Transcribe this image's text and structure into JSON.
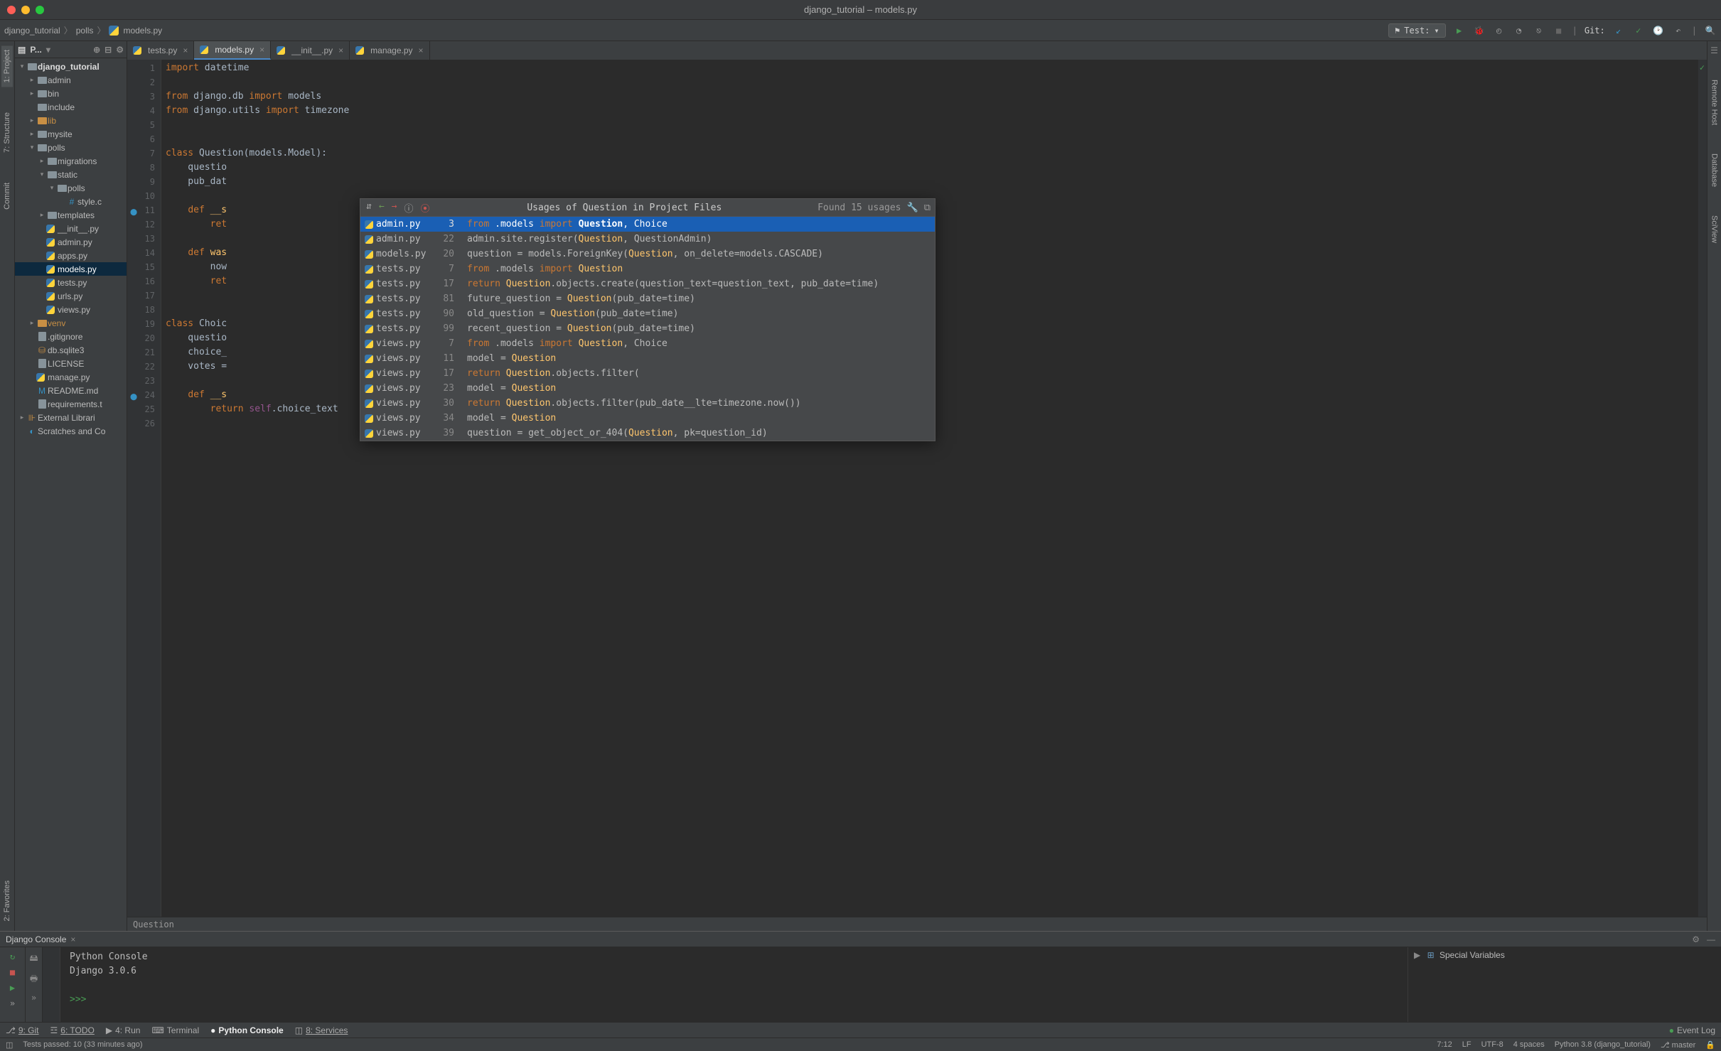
{
  "window_title": "django_tutorial – models.py",
  "breadcrumb": [
    "django_tutorial",
    "polls",
    "models.py"
  ],
  "run_config": {
    "icon": "Test:",
    "label": "Test:"
  },
  "toolbar_icons": [
    "run",
    "debug",
    "coverage",
    "profile",
    "concurrency",
    "stop",
    "git-update",
    "git-commit",
    "git-history",
    "revert",
    "search"
  ],
  "git_label": "Git:",
  "left_tool_tabs": [
    {
      "name": "1: Project",
      "active": true
    },
    {
      "name": "7: Structure",
      "active": false
    },
    {
      "name": "Commit",
      "active": false
    },
    {
      "name": "2: Favorites",
      "active": false
    }
  ],
  "right_tool_tabs": [
    "Remote Host",
    "Database",
    "SciView"
  ],
  "project_panel": {
    "title": "P...",
    "tree": [
      {
        "d": 0,
        "exp": "v",
        "t": "folder",
        "label": "django_tutorial",
        "bold": true
      },
      {
        "d": 1,
        "exp": ">",
        "t": "folder",
        "label": "admin"
      },
      {
        "d": 1,
        "exp": ">",
        "t": "folder",
        "label": "bin"
      },
      {
        "d": 1,
        "exp": "",
        "t": "folder",
        "label": "include"
      },
      {
        "d": 1,
        "exp": ">",
        "t": "folder-lib",
        "label": "lib"
      },
      {
        "d": 1,
        "exp": ">",
        "t": "folder",
        "label": "mysite"
      },
      {
        "d": 1,
        "exp": "v",
        "t": "folder",
        "label": "polls"
      },
      {
        "d": 2,
        "exp": ">",
        "t": "folder",
        "label": "migrations"
      },
      {
        "d": 2,
        "exp": "v",
        "t": "folder",
        "label": "static"
      },
      {
        "d": 3,
        "exp": "v",
        "t": "folder",
        "label": "polls"
      },
      {
        "d": 4,
        "exp": "",
        "t": "css",
        "label": "style.c"
      },
      {
        "d": 2,
        "exp": ">",
        "t": "folder",
        "label": "templates"
      },
      {
        "d": 2,
        "exp": "",
        "t": "py",
        "label": "__init__.py"
      },
      {
        "d": 2,
        "exp": "",
        "t": "py",
        "label": "admin.py"
      },
      {
        "d": 2,
        "exp": "",
        "t": "py",
        "label": "apps.py"
      },
      {
        "d": 2,
        "exp": "",
        "t": "py",
        "label": "models.py",
        "sel": true
      },
      {
        "d": 2,
        "exp": "",
        "t": "py",
        "label": "tests.py"
      },
      {
        "d": 2,
        "exp": "",
        "t": "py",
        "label": "urls.py"
      },
      {
        "d": 2,
        "exp": "",
        "t": "py",
        "label": "views.py"
      },
      {
        "d": 1,
        "exp": ">",
        "t": "folder-lib",
        "label": "venv"
      },
      {
        "d": 1,
        "exp": "",
        "t": "file",
        "label": ".gitignore"
      },
      {
        "d": 1,
        "exp": "",
        "t": "db",
        "label": "db.sqlite3"
      },
      {
        "d": 1,
        "exp": "",
        "t": "file",
        "label": "LICENSE"
      },
      {
        "d": 1,
        "exp": "",
        "t": "py",
        "label": "manage.py"
      },
      {
        "d": 1,
        "exp": "",
        "t": "md",
        "label": "README.md"
      },
      {
        "d": 1,
        "exp": "",
        "t": "file",
        "label": "requirements.t"
      },
      {
        "d": 0,
        "exp": ">",
        "t": "lib",
        "label": "External Librari"
      },
      {
        "d": 0,
        "exp": "",
        "t": "scratch",
        "label": "Scratches and Co"
      }
    ]
  },
  "tabs": [
    {
      "label": "tests.py",
      "active": false
    },
    {
      "label": "models.py",
      "active": true
    },
    {
      "label": "__init__.py",
      "active": false
    },
    {
      "label": "manage.py",
      "active": false
    }
  ],
  "code": {
    "lines": [
      {
        "n": 1,
        "html": "<span class='kw'>import</span> datetime"
      },
      {
        "n": 2,
        "html": ""
      },
      {
        "n": 3,
        "html": "<span class='kw'>from</span> django.db <span class='kw'>import</span> models"
      },
      {
        "n": 4,
        "html": "<span class='kw'>from</span> django.utils <span class='kw'>import</span> timezone"
      },
      {
        "n": 5,
        "html": ""
      },
      {
        "n": 6,
        "html": ""
      },
      {
        "n": 7,
        "html": "<span class='kw'>class</span> Question(models.Model):",
        "caret": true
      },
      {
        "n": 8,
        "html": "    questio"
      },
      {
        "n": 9,
        "html": "    pub_dat"
      },
      {
        "n": 10,
        "html": ""
      },
      {
        "n": 11,
        "html": "    <span class='kw'>def</span> <span class='fn'>__s</span>",
        "icon": "o"
      },
      {
        "n": 12,
        "html": "        <span class='kw'>ret</span>"
      },
      {
        "n": 13,
        "html": ""
      },
      {
        "n": 14,
        "html": "    <span class='kw'>def</span> <span class='fn'>was</span>"
      },
      {
        "n": 15,
        "html": "        now"
      },
      {
        "n": 16,
        "html": "        <span class='kw'>ret</span>"
      },
      {
        "n": 17,
        "html": ""
      },
      {
        "n": 18,
        "html": ""
      },
      {
        "n": 19,
        "html": "<span class='kw'>class</span> Choic"
      },
      {
        "n": 20,
        "html": "    questio"
      },
      {
        "n": 21,
        "html": "    choice_"
      },
      {
        "n": 22,
        "html": "    votes ="
      },
      {
        "n": 23,
        "html": ""
      },
      {
        "n": 24,
        "html": "    <span class='kw'>def</span> <span class='fn'>__s</span>",
        "icon": "o"
      },
      {
        "n": 25,
        "html": "        <span class='kw'>return</span> <span class='self'>self</span>.choice_text"
      },
      {
        "n": 26,
        "html": ""
      }
    ]
  },
  "editor_breadcrumb": "Question",
  "usages": {
    "title": "Usages of Question in Project Files",
    "found": "Found 15 usages",
    "rows": [
      {
        "file": "admin.py",
        "line": 3,
        "sel": true,
        "html": "<span class='kw'>from</span> .models <span class='kw'>import</span> <span class='hl'>Question</span>, Choice"
      },
      {
        "file": "admin.py",
        "line": 22,
        "html": "admin.site.register(<span class='hl'>Question</span>, QuestionAdmin)"
      },
      {
        "file": "models.py",
        "line": 20,
        "html": "question = models.ForeignKey(<span class='hl'>Question</span>, on_delete=models.CASCADE)"
      },
      {
        "file": "tests.py",
        "line": 7,
        "html": "<span class='kw'>from</span> .models <span class='kw'>import</span> <span class='hl'>Question</span>"
      },
      {
        "file": "tests.py",
        "line": 17,
        "html": "<span class='kw'>return</span> <span class='hl'>Question</span>.objects.create(question_text=question_text, pub_date=time)"
      },
      {
        "file": "tests.py",
        "line": 81,
        "html": "future_question = <span class='hl'>Question</span>(pub_date=time)"
      },
      {
        "file": "tests.py",
        "line": 90,
        "html": "old_question = <span class='hl'>Question</span>(pub_date=time)"
      },
      {
        "file": "tests.py",
        "line": 99,
        "html": "recent_question = <span class='hl'>Question</span>(pub_date=time)"
      },
      {
        "file": "views.py",
        "line": 7,
        "html": "<span class='kw'>from</span> .models <span class='kw'>import</span> <span class='hl'>Question</span>, Choice"
      },
      {
        "file": "views.py",
        "line": 11,
        "html": "model = <span class='hl'>Question</span>"
      },
      {
        "file": "views.py",
        "line": 17,
        "html": "<span class='kw'>return</span> <span class='hl'>Question</span>.objects.filter("
      },
      {
        "file": "views.py",
        "line": 23,
        "html": "model = <span class='hl'>Question</span>"
      },
      {
        "file": "views.py",
        "line": 30,
        "html": "<span class='kw'>return</span> <span class='hl'>Question</span>.objects.filter(pub_date__lte=timezone.now())"
      },
      {
        "file": "views.py",
        "line": 34,
        "html": "model = <span class='hl'>Question</span>"
      },
      {
        "file": "views.py",
        "line": 39,
        "html": "question = get_object_or_404(<span class='hl'>Question</span>, pk=question_id)"
      }
    ]
  },
  "console": {
    "tab_name": "Django Console",
    "lines": [
      "Python Console",
      "Django 3.0.6",
      "",
      ">>> "
    ],
    "vars_title": "Special Variables"
  },
  "bottom_tools": [
    {
      "label": "9: Git",
      "u": true
    },
    {
      "label": "6: TODO",
      "u": true
    },
    {
      "label": "4: Run"
    },
    {
      "label": "Terminal"
    },
    {
      "label": "Python Console",
      "active": true
    },
    {
      "label": "8: Services",
      "u": true
    }
  ],
  "event_log": "Event Log",
  "status_left": "Tests passed: 10 (33 minutes ago)",
  "status_right": [
    "7:12",
    "LF",
    "UTF-8",
    "4 spaces",
    "Python 3.8 (django_tutorial)",
    "master"
  ]
}
